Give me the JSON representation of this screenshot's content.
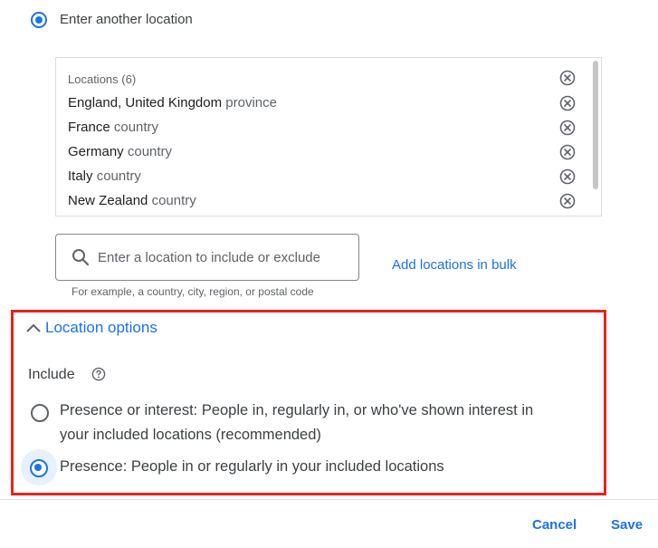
{
  "target": {
    "option_label": "Enter another location",
    "selected": true
  },
  "locations": {
    "header": "Locations (6)",
    "items": [
      {
        "name": "England, United Kingdom",
        "type": "province"
      },
      {
        "name": "France",
        "type": "country"
      },
      {
        "name": "Germany",
        "type": "country"
      },
      {
        "name": "Italy",
        "type": "country"
      },
      {
        "name": "New Zealand",
        "type": "country"
      }
    ],
    "remove_icon": "close-circle-icon"
  },
  "search": {
    "placeholder": "Enter a location to include or exclude",
    "value": "",
    "helper": "For example, a country, city, region, or postal code",
    "icon": "search-icon"
  },
  "bulk_link": "Add locations in bulk",
  "location_options": {
    "toggle_label": "Location options",
    "expanded": true,
    "include_label": "Include",
    "help_icon": "help-circle-icon",
    "options": [
      {
        "line1": "Presence or interest: People in, regularly in, or who've shown interest in",
        "line2": "your included locations (recommended)",
        "selected": false
      },
      {
        "line1": "Presence: People in or regularly in your included locations",
        "selected": true
      }
    ]
  },
  "footer": {
    "cancel_label": "Cancel",
    "save_label": "Save"
  },
  "colors": {
    "accent": "#1a73e8",
    "highlight_border": "#e8231c"
  }
}
